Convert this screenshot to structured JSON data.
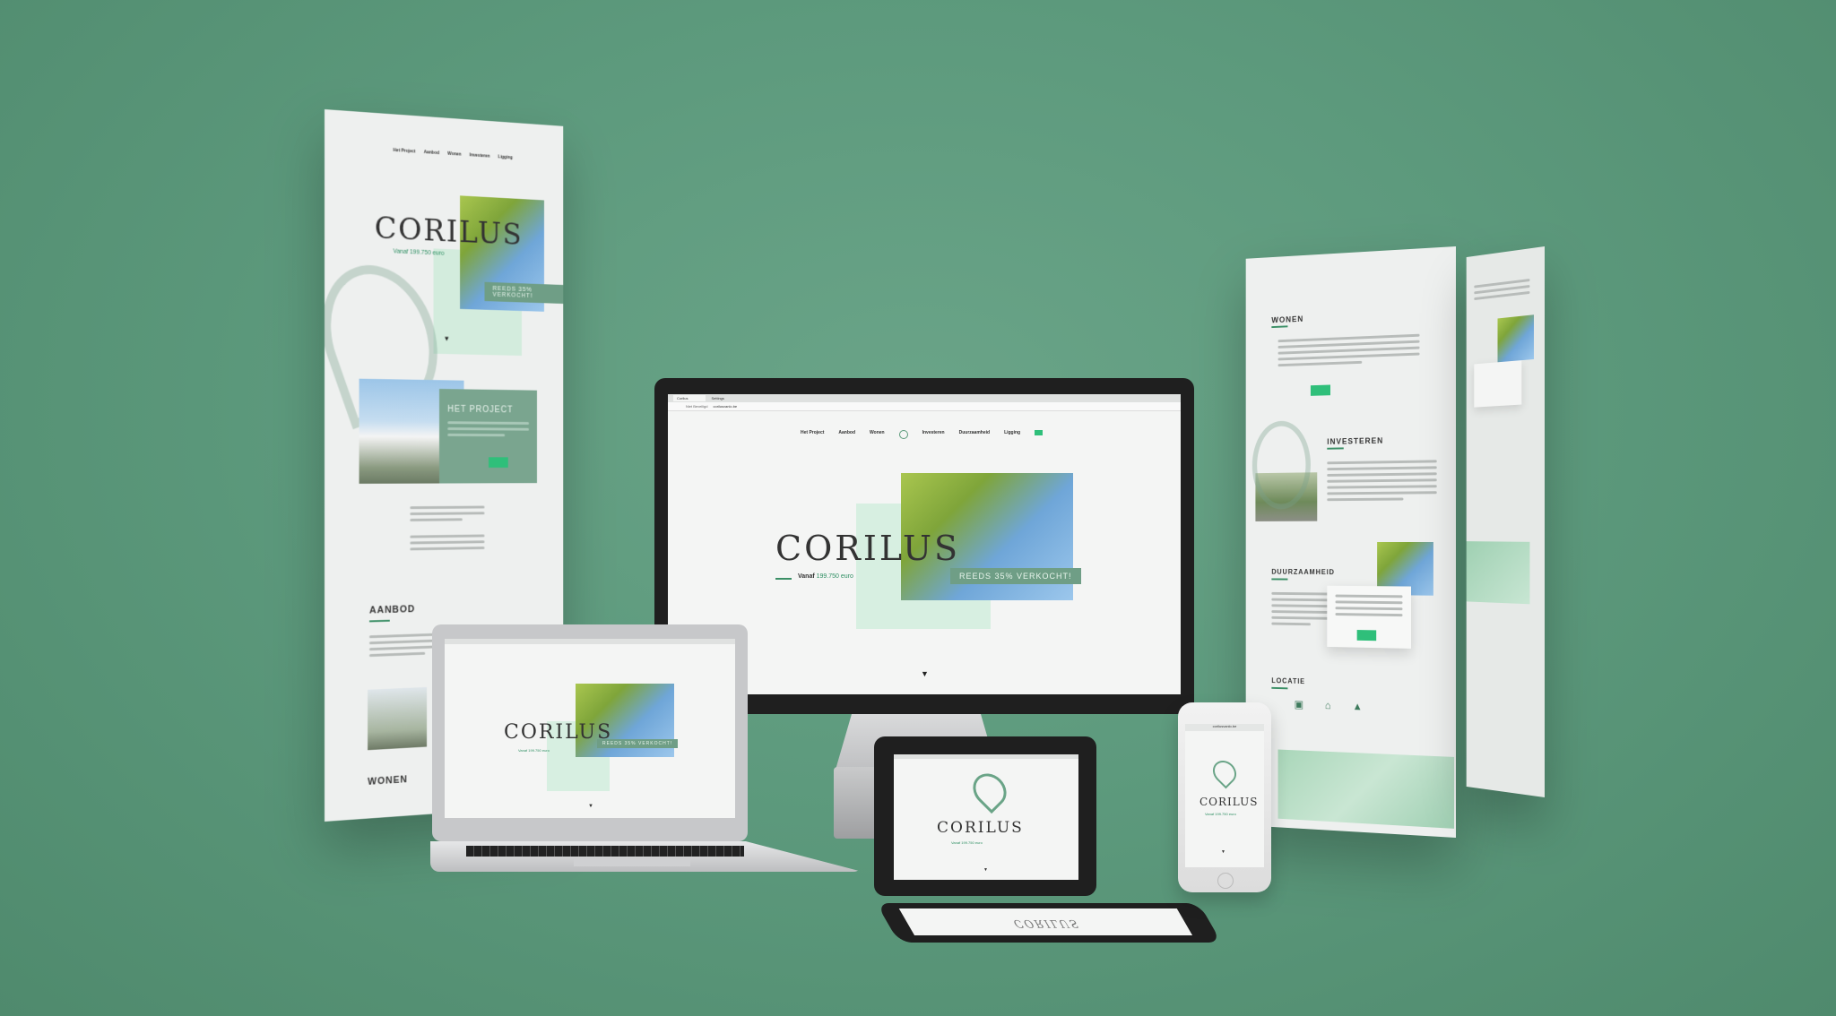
{
  "brand": "CORILUS",
  "subtitle": "Vanaf 199.750 euro",
  "subtitle_prefix": "Vanaf",
  "subtitle_price": "199.750 euro",
  "sold_badge": "REEDS 35% VERKOCHT!",
  "nav": {
    "items": [
      "Het Project",
      "Aanbod",
      "Wonen",
      "Investeren",
      "Duurzaamheid",
      "Ligging"
    ]
  },
  "browser": {
    "tab1": "Corilus",
    "tab2": "Settings",
    "address_secure": "Niet Beveiligd",
    "url": "corilusvanlo.be"
  },
  "sections": {
    "het_project": "HET PROJECT",
    "aanbod": "AANBOD",
    "wonen": "WONEN",
    "investeren": "INVESTEREN",
    "duurzaamheid": "DUURZAAMHEID",
    "locatie": "LOCATIE"
  },
  "colors": {
    "background": "#5d9a7d",
    "accent": "#2fbf7a",
    "brand_green": "#2f8f63"
  }
}
